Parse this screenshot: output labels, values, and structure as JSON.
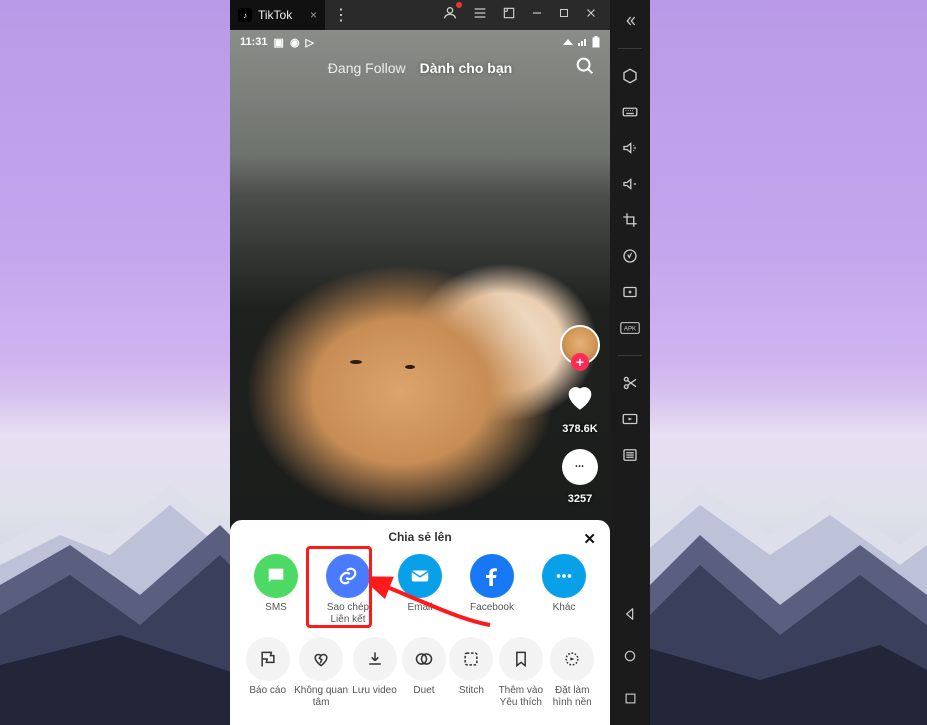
{
  "window": {
    "tab_title": "TikTok"
  },
  "status": {
    "time": "11:31"
  },
  "feed_tabs": {
    "following": "Đang Follow",
    "for_you": "Dành cho bạn"
  },
  "overlay": {
    "like_count": "378.6K",
    "comment_count": "3257"
  },
  "share": {
    "title": "Chia sẻ lên",
    "row1": {
      "sms": "SMS",
      "copylink_l1": "Sao chép",
      "copylink_l2": "Liên kết",
      "email": "Email",
      "facebook": "Facebook",
      "more": "Khác"
    },
    "row2": {
      "report": "Báo cáo",
      "notinterested_l1": "Không quan",
      "notinterested_l2": "tâm",
      "save": "Lưu video",
      "duet": "Duet",
      "stitch": "Stitch",
      "favorite_l1": "Thêm vào",
      "favorite_l2": "Yêu thích",
      "wallpaper_l1": "Đặt làm",
      "wallpaper_l2": "hình nền"
    }
  }
}
